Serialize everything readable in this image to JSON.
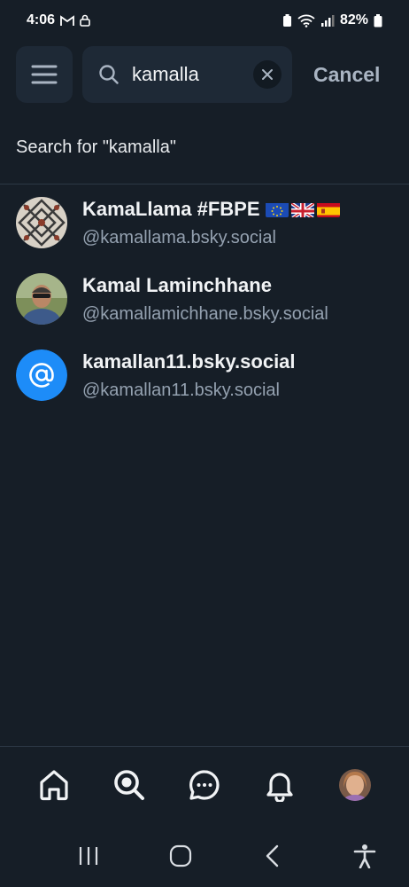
{
  "status_bar": {
    "time": "4:06",
    "battery": "82%"
  },
  "search": {
    "query": "kamalla",
    "cancel_label": "Cancel",
    "search_for_label": "Search for \"kamalla\""
  },
  "results": [
    {
      "name": "KamaLlama #FBPE",
      "handle": "@kamallama.bsky.social",
      "flags": [
        "eu-flag",
        "uk-flag",
        "spain-flag"
      ]
    },
    {
      "name": "Kamal Laminchhane",
      "handle": "@kamallamichhane.bsky.social"
    },
    {
      "name": "kamallan11.bsky.social",
      "handle": "@kamallan11.bsky.social"
    }
  ],
  "colors": {
    "background": "#161e27",
    "surface": "#1e2936",
    "accent": "#1d8cf8",
    "muted_text": "#94a1b0"
  },
  "icons": {
    "tabs": [
      "home-icon",
      "search-icon",
      "chat-icon",
      "notifications-icon",
      "profile-avatar"
    ],
    "nav": [
      "recents-icon",
      "home-circle-icon",
      "back-icon",
      "accessibility-icon"
    ]
  }
}
